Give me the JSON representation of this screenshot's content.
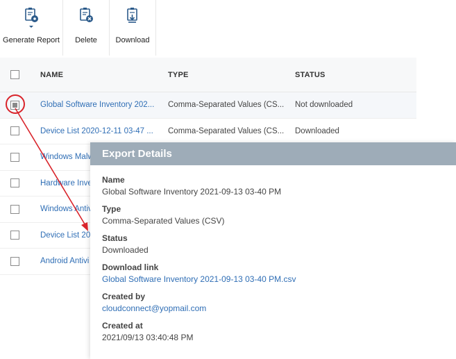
{
  "toolbar": {
    "generate_report": "Generate Report",
    "delete": "Delete",
    "download": "Download"
  },
  "table": {
    "headers": {
      "name": "NAME",
      "type": "TYPE",
      "status": "STATUS"
    },
    "rows": [
      {
        "name": "Global Software Inventory 202...",
        "type": "Comma-Separated Values (CS...",
        "status": "Not downloaded",
        "selected": true
      },
      {
        "name": "Device List 2020-12-11 03-47 ...",
        "type": "Comma-Separated Values (CS...",
        "status": "Downloaded"
      },
      {
        "name": "Windows Malw",
        "type": "",
        "status": ""
      },
      {
        "name": "Hardware Inve",
        "type": "",
        "status": ""
      },
      {
        "name": "Windows Antiv",
        "type": "",
        "status": ""
      },
      {
        "name": "Device List 20",
        "type": "",
        "status": ""
      },
      {
        "name": "Android Antivi",
        "type": "",
        "status": ""
      }
    ]
  },
  "panel": {
    "title": "Export Details",
    "fields": {
      "name": {
        "label": "Name",
        "value": "Global Software Inventory 2021-09-13 03-40 PM"
      },
      "type": {
        "label": "Type",
        "value": "Comma-Separated Values (CSV)"
      },
      "status": {
        "label": "Status",
        "value": "Downloaded"
      },
      "download_link": {
        "label": "Download link",
        "value": "Global Software Inventory 2021-09-13 03-40 PM.csv"
      },
      "created_by": {
        "label": "Created by",
        "value": "cloudconnect@yopmail.com"
      },
      "created_at": {
        "label": "Created at",
        "value": "2021/09/13 03:40:48 PM"
      }
    }
  },
  "colors": {
    "link": "#2f6eb5",
    "panel_header": "#9eacb8",
    "annotation": "#d9232a",
    "icon": "#2b5a8a"
  },
  "icons": {
    "generate_report": "report-gear-icon",
    "delete": "report-delete-icon",
    "download": "report-download-icon"
  }
}
